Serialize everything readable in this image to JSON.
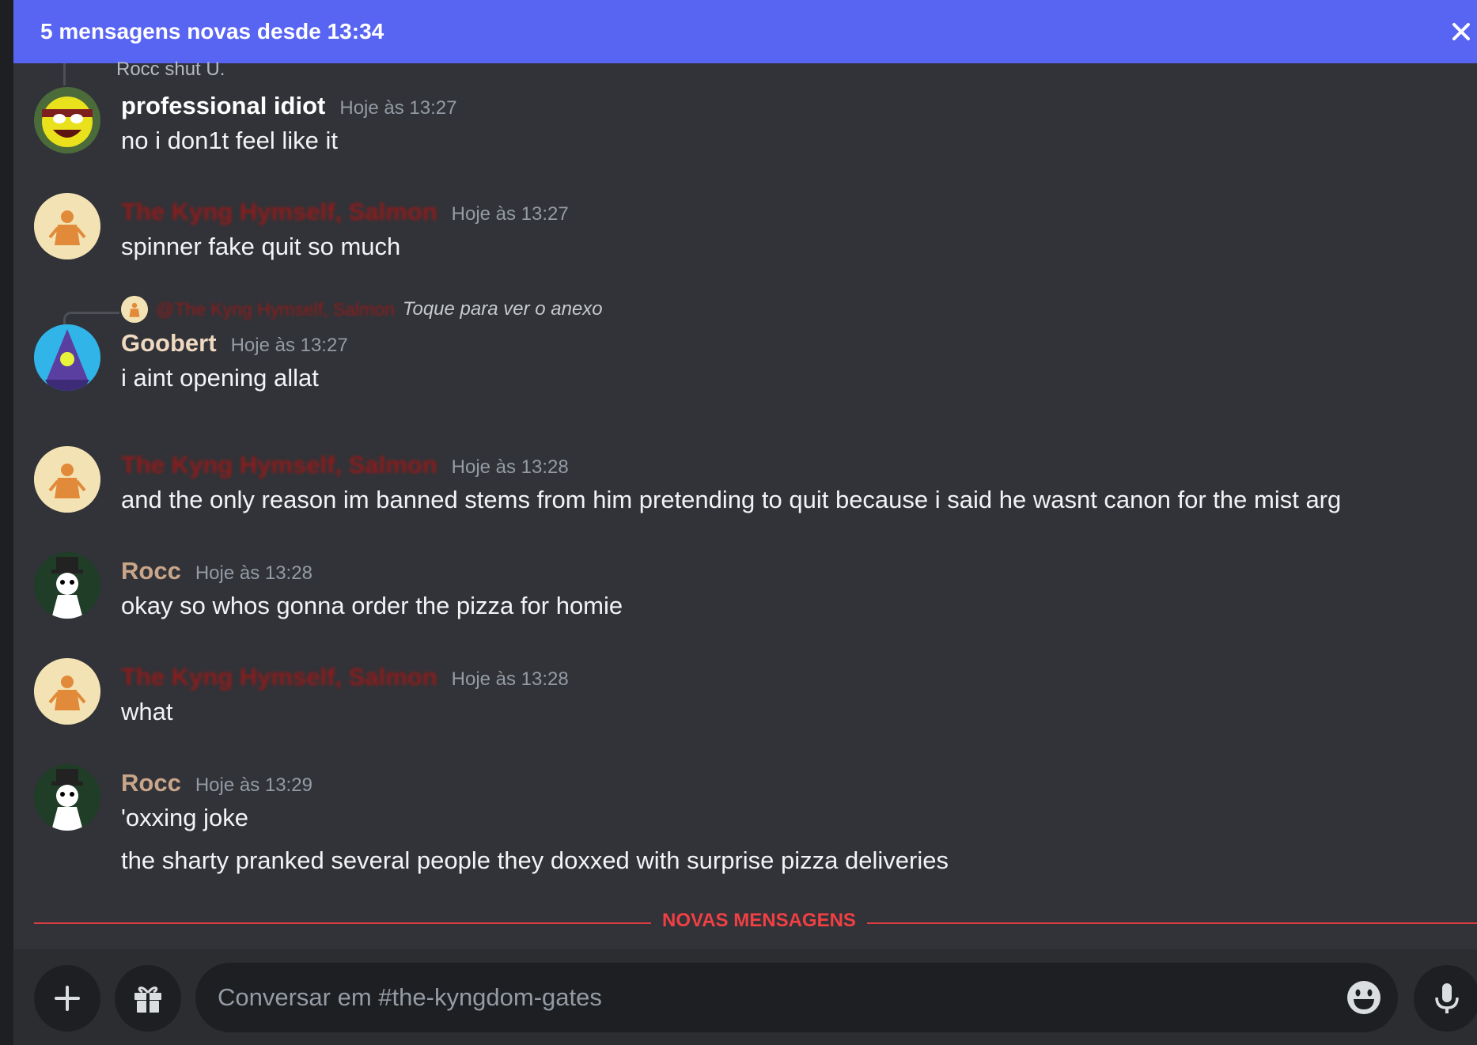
{
  "banner": {
    "text": "5 mensagens novas desde 13:34"
  },
  "peek": {
    "text": "Rocc shut U."
  },
  "users": {
    "idiot": {
      "name": "professional idiot",
      "color": "#ffffff"
    },
    "salmon": {
      "name": "The Kyng Hymself, Salmon",
      "color": "#8e1c1c"
    },
    "goobert": {
      "name": "Goobert",
      "color": "#f0d9c0"
    },
    "rocc": {
      "name": "Rocc",
      "color": "#c9a58a"
    }
  },
  "messages": [
    {
      "author": "professional idiot",
      "timestamp": "Hoje às 13:27",
      "lines": [
        "no i don1t feel like it"
      ]
    },
    {
      "author": "The Kyng Hymself, Salmon",
      "timestamp": "Hoje às 13:27",
      "lines": [
        "spinner fake quit so much"
      ]
    },
    {
      "reply": {
        "mention": "@The Kyng Hymself, Salmon",
        "hint": "Toque para ver o anexo"
      },
      "author": "Goobert",
      "timestamp": "Hoje às 13:27",
      "lines": [
        "i aint opening allat"
      ]
    },
    {
      "author": "The Kyng Hymself, Salmon",
      "timestamp": "Hoje às 13:28",
      "lines": [
        "and the only reason im banned stems from him pretending to quit because i said he wasnt canon for the mist arg"
      ]
    },
    {
      "author": "Rocc",
      "timestamp": "Hoje às 13:28",
      "lines": [
        "okay so whos gonna order the pizza for homie"
      ]
    },
    {
      "author": "The Kyng Hymself, Salmon",
      "timestamp": "Hoje às 13:28",
      "lines": [
        "what"
      ]
    },
    {
      "author": "Rocc",
      "timestamp": "Hoje às 13:29",
      "lines": [
        "'oxxing joke",
        "the sharty pranked several people they doxxed with surprise pizza deliveries"
      ]
    }
  ],
  "divider": {
    "label": "NOVAS MENSAGENS"
  },
  "composer": {
    "placeholder": "Conversar em #the-kyngdom-gates"
  },
  "icons": {
    "close": "close-icon",
    "plus": "plus-icon",
    "gift": "gift-icon",
    "emoji": "emoji-icon",
    "mic": "microphone-icon"
  },
  "colors": {
    "banner": "#5865f2",
    "background": "#313338",
    "divider": "#f23f43"
  }
}
